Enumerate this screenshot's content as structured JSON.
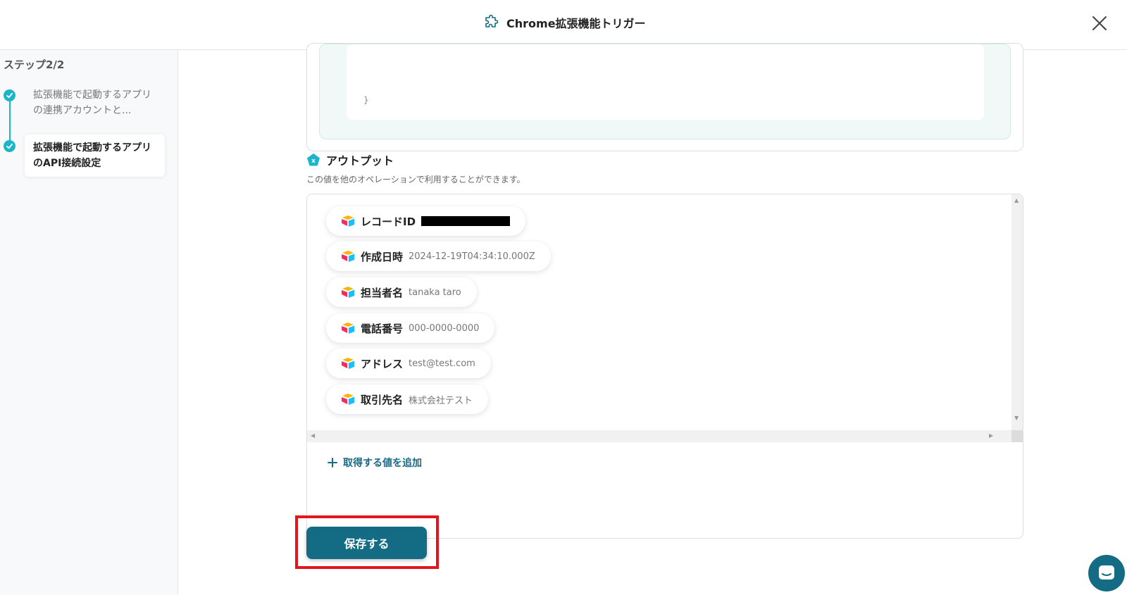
{
  "header": {
    "title": "Chrome拡張機能トリガー",
    "icon": "puzzle-icon",
    "close_icon": "close-icon"
  },
  "sidebar": {
    "step_count": "ステップ2/2",
    "steps": [
      {
        "label": "拡張機能で起動するアプリの連携アカウントと...",
        "status": "done"
      },
      {
        "label": "拡張機能で起動するアプリのAPI接続設定",
        "status": "active"
      }
    ]
  },
  "output": {
    "title": "アウトプット",
    "description": "この値を他のオペレーションで利用することができます。",
    "items": [
      {
        "label": "レコードID",
        "value": ""
      },
      {
        "label": "作成日時",
        "value": "2024-12-19T04:34:10.000Z"
      },
      {
        "label": "担当者名",
        "value": "tanaka taro"
      },
      {
        "label": "電話番号",
        "value": "000-0000-0000"
      },
      {
        "label": "アドレス",
        "value": "test@test.com"
      },
      {
        "label": "取引先名",
        "value": "株式会社テスト"
      }
    ],
    "add_label": "取得する値を追加"
  },
  "save_button": "保存する",
  "colors": {
    "accent": "#136c84",
    "step_teal": "#1ab5c8",
    "highlight_red": "#e3161e"
  }
}
